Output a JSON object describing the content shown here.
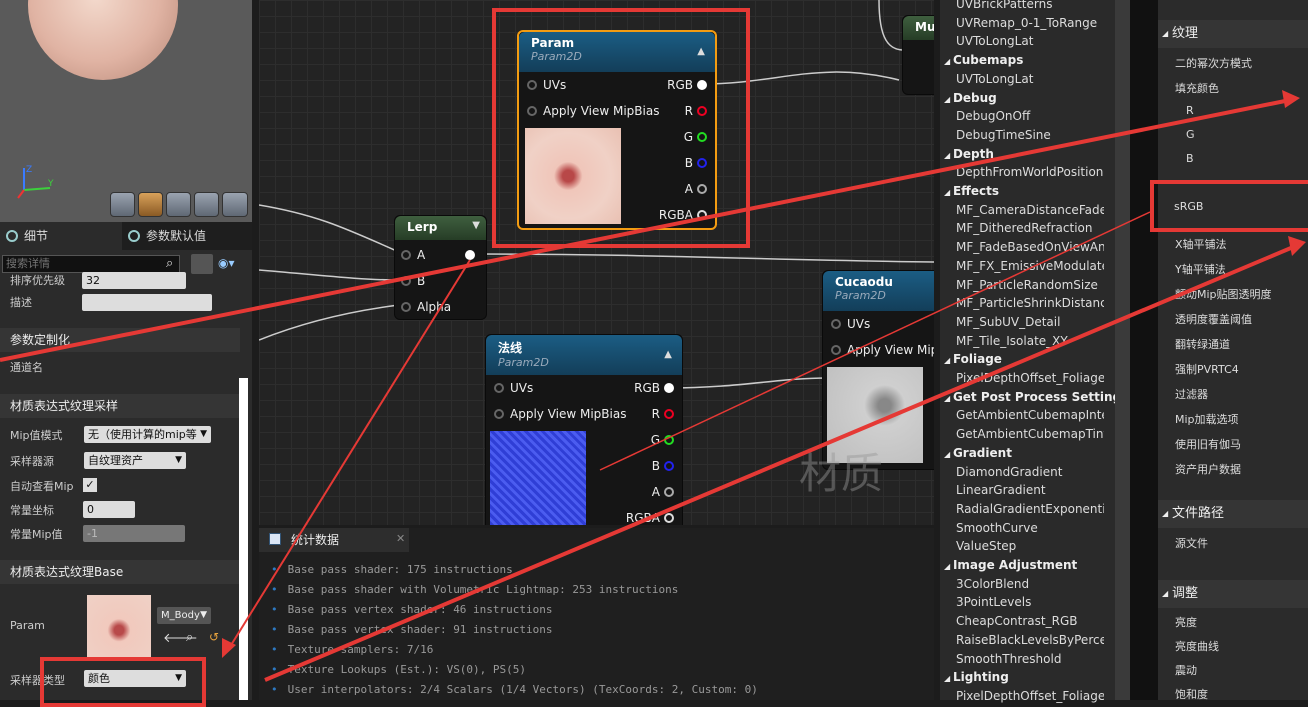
{
  "details_tabs": [
    "细节",
    "参数默认值"
  ],
  "search_placeholder": "搜索详情",
  "rows": {
    "priority_label": "排序优先级",
    "priority_value": "32",
    "desc_label": "描述",
    "group_label": "通道名"
  },
  "sections": {
    "param_custom": "参数定制化",
    "sampler": "材质表达式纹理采样",
    "base": "材质表达式纹理Base"
  },
  "sampler": {
    "mip_label": "Mip值模式",
    "mip_value": "无（使用计算的mip等",
    "source_label": "采样器源",
    "source_value": "自纹理资产",
    "auto_label": "自动查看Mip",
    "const_coord_label": "常量坐标",
    "const_coord_value": "0",
    "const_mip_label": "常量Mip值",
    "const_mip_value": "-1"
  },
  "base": {
    "param_label": "Param",
    "asset": "M_Body",
    "sampler_type_label": "采样器类型",
    "sampler_type_value": "颜色"
  },
  "nodes": {
    "param": {
      "title": "Param",
      "sub": "Param2D",
      "inputs": [
        "UVs",
        "Apply View MipBias"
      ],
      "outputs": [
        "RGB",
        "R",
        "G",
        "B",
        "A",
        "RGBA"
      ]
    },
    "lerp": {
      "title": "Lerp",
      "inputs": [
        "A",
        "B",
        "Alpha"
      ]
    },
    "normal": {
      "title": "法线",
      "sub": "Param2D",
      "inputs": [
        "UVs",
        "Apply View MipBias"
      ],
      "outputs": [
        "RGB",
        "R",
        "G",
        "B",
        "A",
        "RGBA"
      ]
    },
    "cucaodu": {
      "title": "Cucaodu",
      "sub": "Param2D",
      "inputs": [
        "UVs",
        "Apply View Mip"
      ]
    },
    "mul": {
      "title": "Mu"
    }
  },
  "watermark": "材质",
  "stats": {
    "tab": "统计数据",
    "lines": [
      "Base pass shader: 175 instructions",
      "Base pass shader with Volumetric Lightmap: 253 instructions",
      "Base pass vertex shader: 46 instructions",
      "Base pass vertex shader: 91 instructions",
      "Texture samplers: 7/16",
      "Texture Lookups (Est.): VS(0), PS(5)",
      "User interpolators: 2/4 Scalars (1/4 Vectors) (TexCoords: 2, Custom: 0)"
    ]
  },
  "palette": [
    {
      "t": "item",
      "v": "UVBrickPatterns"
    },
    {
      "t": "item",
      "v": "UVRemap_0-1_ToRange"
    },
    {
      "t": "item",
      "v": "UVToLongLat"
    },
    {
      "t": "cat",
      "v": "Cubemaps"
    },
    {
      "t": "item",
      "v": "UVToLongLat"
    },
    {
      "t": "cat",
      "v": "Debug"
    },
    {
      "t": "item",
      "v": "DebugOnOff"
    },
    {
      "t": "item",
      "v": "DebugTimeSine"
    },
    {
      "t": "cat",
      "v": "Depth"
    },
    {
      "t": "item",
      "v": "DepthFromWorldPosition"
    },
    {
      "t": "cat",
      "v": "Effects"
    },
    {
      "t": "item",
      "v": "MF_CameraDistanceFade"
    },
    {
      "t": "item",
      "v": "MF_DitheredRefraction"
    },
    {
      "t": "item",
      "v": "MF_FadeBasedOnViewAn"
    },
    {
      "t": "item",
      "v": "MF_FX_EmissiveModulate"
    },
    {
      "t": "item",
      "v": "MF_ParticleRandomSize"
    },
    {
      "t": "item",
      "v": "MF_ParticleShrinkDistanc"
    },
    {
      "t": "item",
      "v": "MF_SubUV_Detail"
    },
    {
      "t": "item",
      "v": "MF_Tile_Isolate_XY"
    },
    {
      "t": "cat",
      "v": "Foliage"
    },
    {
      "t": "item",
      "v": "PixelDepthOffset_Foliage"
    },
    {
      "t": "cat",
      "v": "Get Post Process Setting"
    },
    {
      "t": "item",
      "v": "GetAmbientCubemapInter"
    },
    {
      "t": "item",
      "v": "GetAmbientCubemapTint"
    },
    {
      "t": "cat",
      "v": "Gradient"
    },
    {
      "t": "item",
      "v": "DiamondGradient"
    },
    {
      "t": "item",
      "v": "LinearGradient"
    },
    {
      "t": "item",
      "v": "RadialGradientExponentia"
    },
    {
      "t": "item",
      "v": "SmoothCurve"
    },
    {
      "t": "item",
      "v": "ValueStep"
    },
    {
      "t": "cat",
      "v": "Image Adjustment"
    },
    {
      "t": "item",
      "v": "3ColorBlend"
    },
    {
      "t": "item",
      "v": "3PointLevels"
    },
    {
      "t": "item",
      "v": "CheapContrast_RGB"
    },
    {
      "t": "item",
      "v": "RaiseBlackLevelsByPerce"
    },
    {
      "t": "item",
      "v": "SmoothThreshold"
    },
    {
      "t": "cat",
      "v": "Lighting"
    },
    {
      "t": "item",
      "v": "PixelDepthOffset_Foliage"
    }
  ],
  "settings": {
    "texture_header": "纹理",
    "items1": [
      "二的幂次方模式",
      "填充颜色",
      "R",
      "G",
      "B"
    ],
    "srgb": "sRGB",
    "items2": [
      "X轴平铺法",
      "Y轴平铺法",
      "颤动Mip贴图透明度",
      "透明度覆盖阈值",
      "翻转绿通道",
      "强制PVRTC4",
      "过滤器",
      "Mip加载选项",
      "使用旧有伽马",
      "资产用户数据"
    ],
    "path_header": "文件路径",
    "path_item": "源文件",
    "adjust_header": "调整",
    "adjust_items": [
      "亮度",
      "亮度曲线",
      "震动",
      "饱和度"
    ]
  }
}
